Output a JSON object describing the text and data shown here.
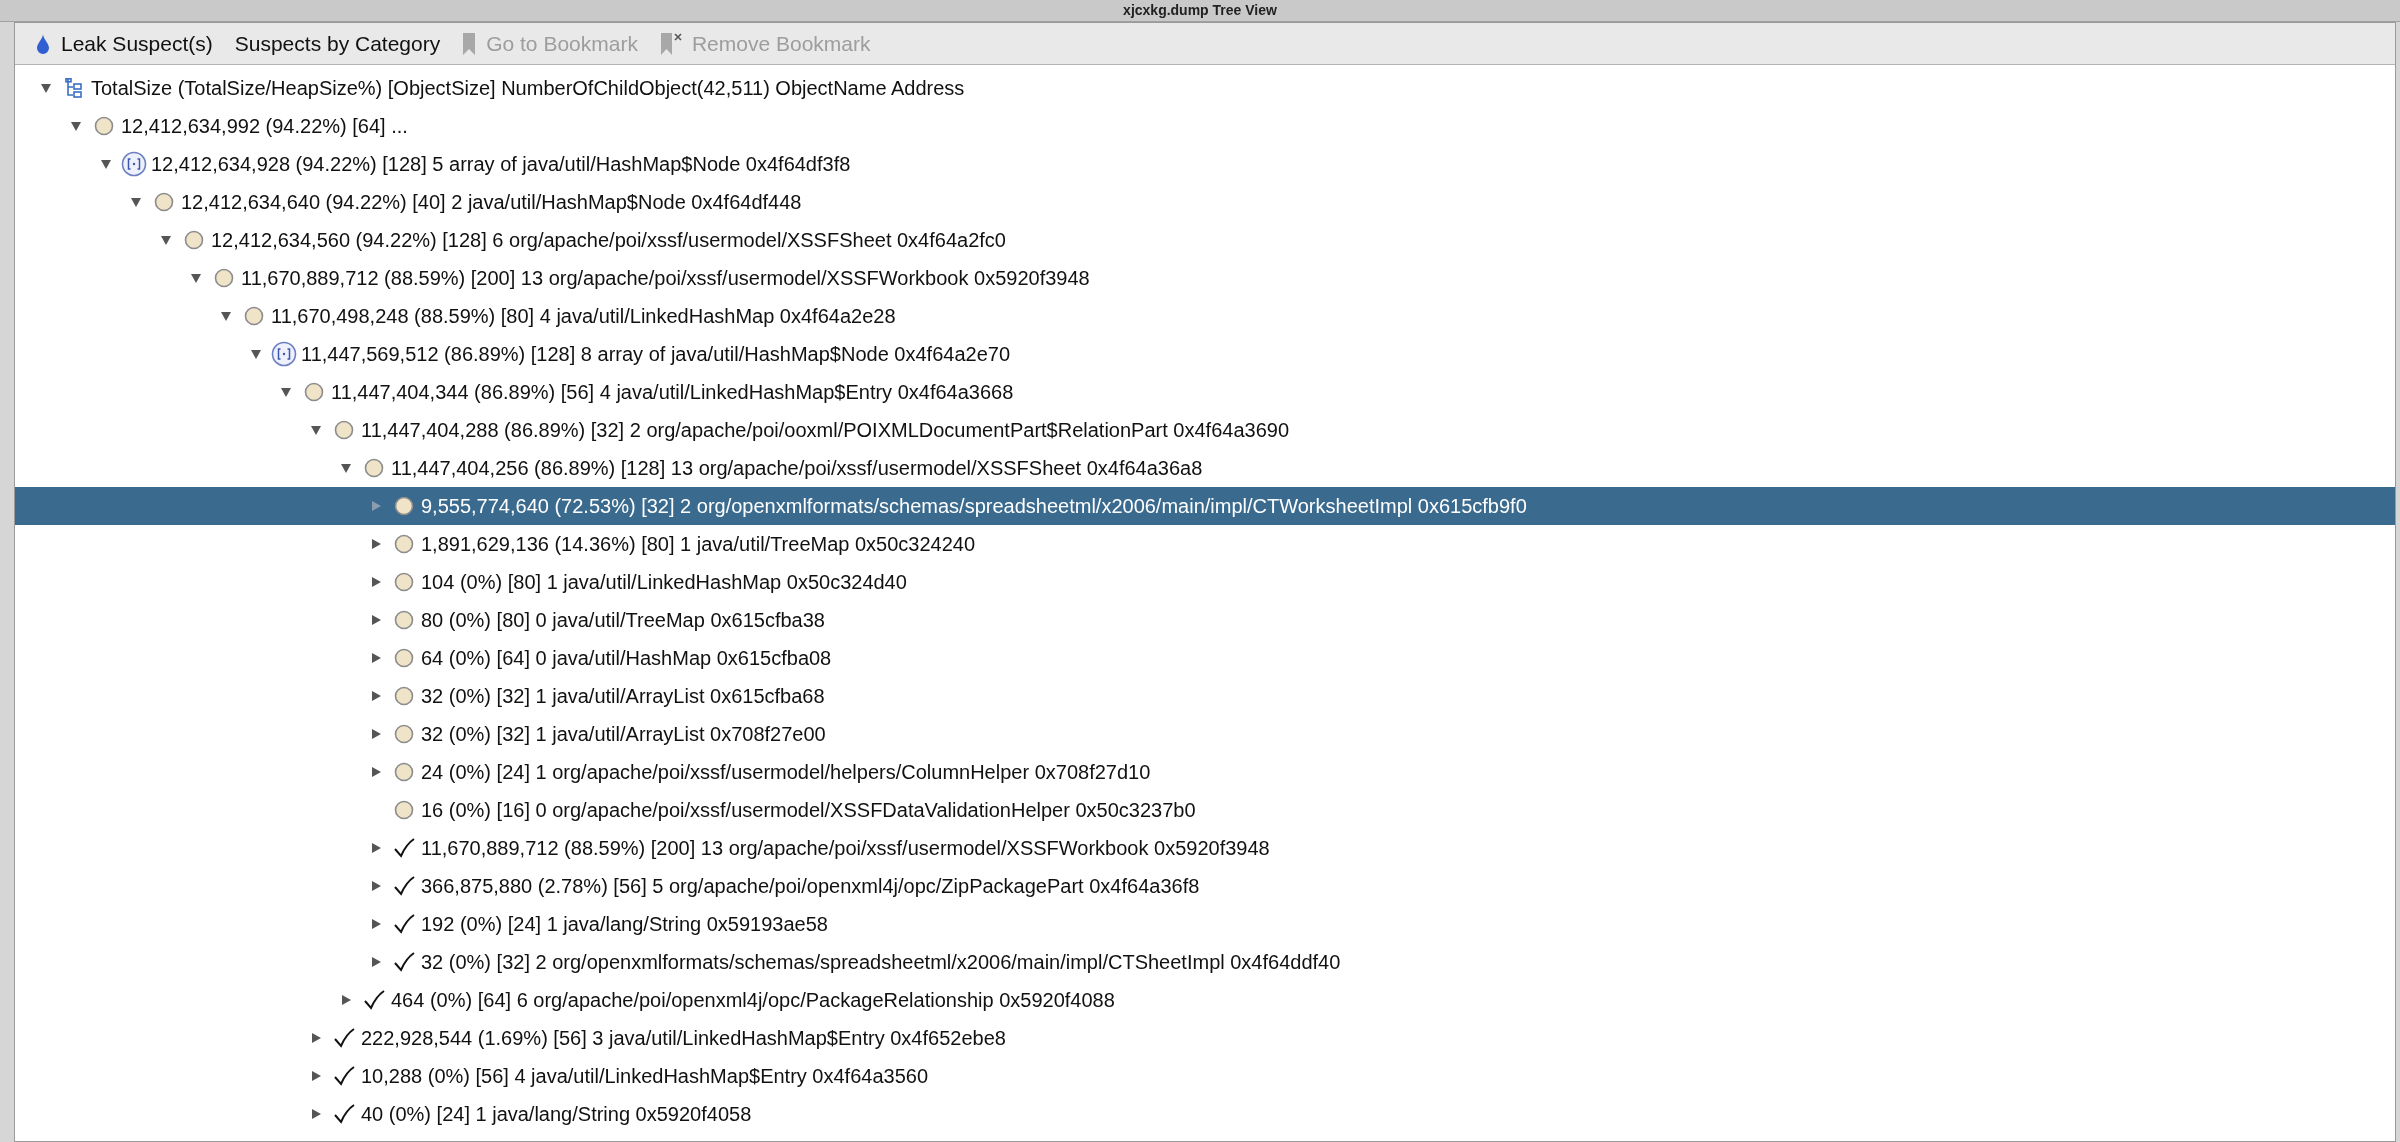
{
  "window": {
    "title": "xjcxkg.dump Tree View"
  },
  "toolbar": [
    {
      "label": "Leak Suspect(s)",
      "kind": "drop",
      "disabled": false
    },
    {
      "label": "Suspects by Category",
      "kind": "plain",
      "disabled": false
    },
    {
      "label": "Go to Bookmark",
      "kind": "bookmark",
      "disabled": true
    },
    {
      "label": "Remove Bookmark",
      "kind": "unbookmark",
      "disabled": true
    }
  ],
  "tree": {
    "kind": "header",
    "text": "TotalSize (TotalSize/HeapSize%) [ObjectSize] NumberOfChildObject(42,511) ObjectName Address",
    "expanded": true,
    "selected": false,
    "children": [
      {
        "kind": "object",
        "text": "12,412,634,992 (94.22%) [64] ...",
        "expanded": true,
        "selected": false,
        "children": [
          {
            "kind": "array",
            "text": "12,412,634,928 (94.22%) [128] 5 array of java/util/HashMap$Node 0x4f64df3f8",
            "expanded": true,
            "selected": false,
            "children": [
              {
                "kind": "object",
                "text": "12,412,634,640 (94.22%) [40] 2 java/util/HashMap$Node 0x4f64df448",
                "expanded": true,
                "selected": false,
                "children": [
                  {
                    "kind": "object",
                    "text": "12,412,634,560 (94.22%) [128] 6 org/apache/poi/xssf/usermodel/XSSFSheet 0x4f64a2fc0",
                    "expanded": true,
                    "selected": false,
                    "children": [
                      {
                        "kind": "object",
                        "text": "11,670,889,712 (88.59%) [200] 13 org/apache/poi/xssf/usermodel/XSSFWorkbook 0x5920f3948",
                        "expanded": true,
                        "selected": false,
                        "children": [
                          {
                            "kind": "object",
                            "text": "11,670,498,248 (88.59%) [80] 4 java/util/LinkedHashMap 0x4f64a2e28",
                            "expanded": true,
                            "selected": false,
                            "children": [
                              {
                                "kind": "array",
                                "text": "11,447,569,512 (86.89%) [128] 8 array of java/util/HashMap$Node 0x4f64a2e70",
                                "expanded": true,
                                "selected": false,
                                "children": [
                                  {
                                    "kind": "object",
                                    "text": "11,447,404,344 (86.89%) [56] 4 java/util/LinkedHashMap$Entry 0x4f64a3668",
                                    "expanded": true,
                                    "selected": false,
                                    "children": [
                                      {
                                        "kind": "object",
                                        "text": "11,447,404,288 (86.89%) [32] 2 org/apache/poi/ooxml/POIXMLDocumentPart$RelationPart 0x4f64a3690",
                                        "expanded": true,
                                        "selected": false,
                                        "children": [
                                          {
                                            "kind": "object",
                                            "text": "11,447,404,256 (86.89%) [128] 13 org/apache/poi/xssf/usermodel/XSSFSheet 0x4f64a36a8",
                                            "expanded": true,
                                            "selected": false,
                                            "children": [
                                              {
                                                "kind": "object",
                                                "text": "9,555,774,640 (72.53%) [32] 2 org/openxmlformats/schemas/spreadsheetml/x2006/main/impl/CTWorksheetImpl 0x615cfb9f0",
                                                "expanded": false,
                                                "selected": true
                                              },
                                              {
                                                "kind": "object",
                                                "text": "1,891,629,136 (14.36%) [80] 1 java/util/TreeMap 0x50c324240",
                                                "expanded": false,
                                                "selected": false
                                              },
                                              {
                                                "kind": "object",
                                                "text": "104 (0%) [80] 1 java/util/LinkedHashMap 0x50c324d40",
                                                "expanded": false,
                                                "selected": false
                                              },
                                              {
                                                "kind": "object",
                                                "text": "80 (0%) [80] 0 java/util/TreeMap 0x615cfba38",
                                                "expanded": false,
                                                "selected": false
                                              },
                                              {
                                                "kind": "object",
                                                "text": "64 (0%) [64] 0 java/util/HashMap 0x615cfba08",
                                                "expanded": false,
                                                "selected": false
                                              },
                                              {
                                                "kind": "object",
                                                "text": "32 (0%) [32] 1 java/util/ArrayList 0x615cfba68",
                                                "expanded": false,
                                                "selected": false
                                              },
                                              {
                                                "kind": "object",
                                                "text": "32 (0%) [32] 1 java/util/ArrayList 0x708f27e00",
                                                "expanded": false,
                                                "selected": false
                                              },
                                              {
                                                "kind": "object",
                                                "text": "24 (0%) [24] 1 org/apache/poi/xssf/usermodel/helpers/ColumnHelper 0x708f27d10",
                                                "expanded": false,
                                                "selected": false
                                              },
                                              {
                                                "kind": "object",
                                                "text": "16 (0%) [16] 0 org/apache/poi/xssf/usermodel/XSSFDataValidationHelper 0x50c3237b0",
                                                "selected": false
                                              },
                                              {
                                                "kind": "reference",
                                                "text": "11,670,889,712 (88.59%) [200] 13 org/apache/poi/xssf/usermodel/XSSFWorkbook 0x5920f3948",
                                                "expanded": false,
                                                "selected": false
                                              },
                                              {
                                                "kind": "reference",
                                                "text": "366,875,880 (2.78%) [56] 5 org/apache/poi/openxml4j/opc/ZipPackagePart 0x4f64a36f8",
                                                "expanded": false,
                                                "selected": false
                                              },
                                              {
                                                "kind": "reference",
                                                "text": "192 (0%) [24] 1 java/lang/String 0x59193ae58",
                                                "expanded": false,
                                                "selected": false
                                              },
                                              {
                                                "kind": "reference",
                                                "text": "32 (0%) [32] 2 org/openxmlformats/schemas/spreadsheetml/x2006/main/impl/CTSheetImpl 0x4f64ddf40",
                                                "expanded": false,
                                                "selected": false
                                              }
                                            ]
                                          },
                                          {
                                            "kind": "reference",
                                            "text": "464 (0%) [64] 6 org/apache/poi/openxml4j/opc/PackageRelationship 0x5920f4088",
                                            "expanded": false,
                                            "selected": false
                                          }
                                        ]
                                      },
                                      {
                                        "kind": "reference",
                                        "text": "222,928,544 (1.69%) [56] 3 java/util/LinkedHashMap$Entry 0x4f652ebe8",
                                        "expanded": false,
                                        "selected": false
                                      },
                                      {
                                        "kind": "reference",
                                        "text": "10,288 (0%) [56] 4 java/util/LinkedHashMap$Entry 0x4f64a3560",
                                        "expanded": false,
                                        "selected": false
                                      },
                                      {
                                        "kind": "reference",
                                        "text": "40 (0%) [24] 1 java/lang/String 0x5920f4058",
                                        "expanded": false,
                                        "selected": false
                                      }
                                    ]
                                  }
                                ]
                              }
                            ]
                          }
                        ]
                      }
                    ]
                  }
                ]
              }
            ]
          }
        ]
      }
    ]
  }
}
